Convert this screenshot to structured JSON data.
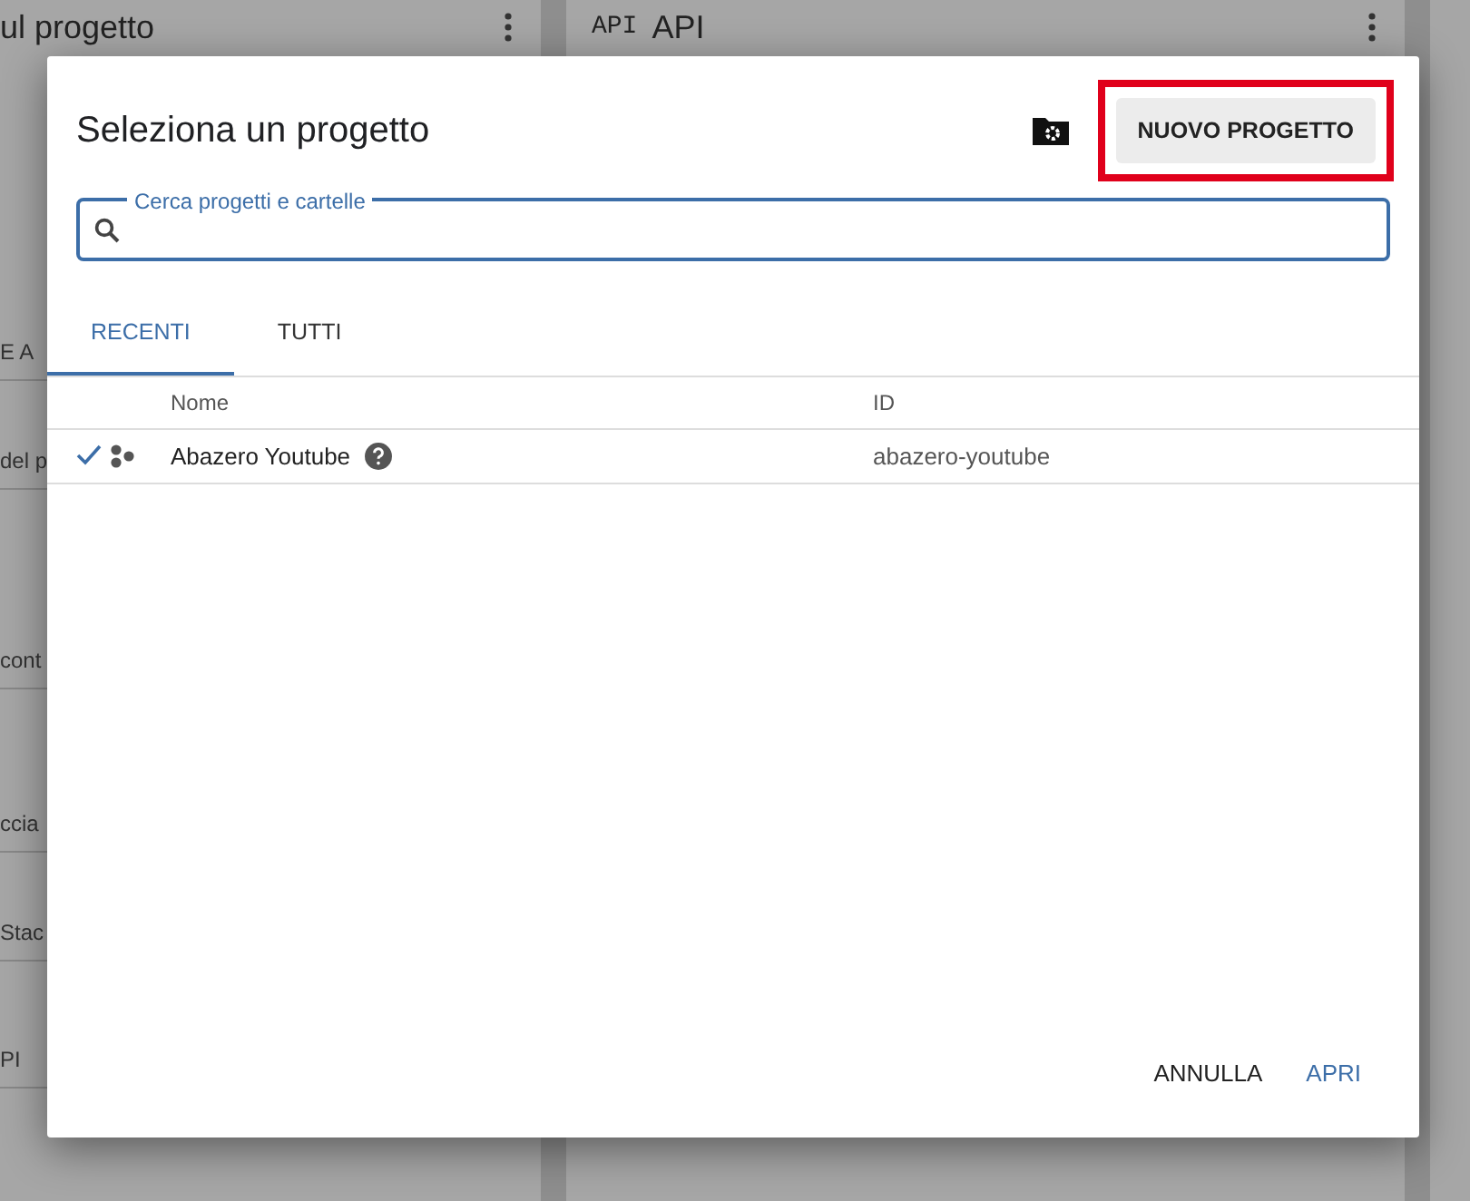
{
  "background": {
    "left_card": {
      "title": "ul progetto",
      "fragments": [
        "E A",
        "del p",
        "cont",
        "ccia",
        "Stac",
        "PI"
      ]
    },
    "right_card": {
      "icon_label": "API",
      "title": "API"
    }
  },
  "dialog": {
    "title": "Seleziona un progetto",
    "new_project_button": "NUOVO PROGETTO",
    "new_project_highlighted": true,
    "search": {
      "label": "Cerca progetti e cartelle"
    },
    "tabs": [
      {
        "label": "RECENTI",
        "selected": true
      },
      {
        "label": "TUTTI",
        "selected": false
      }
    ],
    "table": {
      "columns": [
        "Nome",
        "ID"
      ],
      "rows": [
        {
          "name": "Abazero Youtube",
          "id": "abazero-youtube",
          "selected": true
        }
      ]
    },
    "buttons": [
      {
        "label": "ANNULLA",
        "kind": "cancel"
      },
      {
        "label": "APRI",
        "kind": "open"
      }
    ]
  }
}
